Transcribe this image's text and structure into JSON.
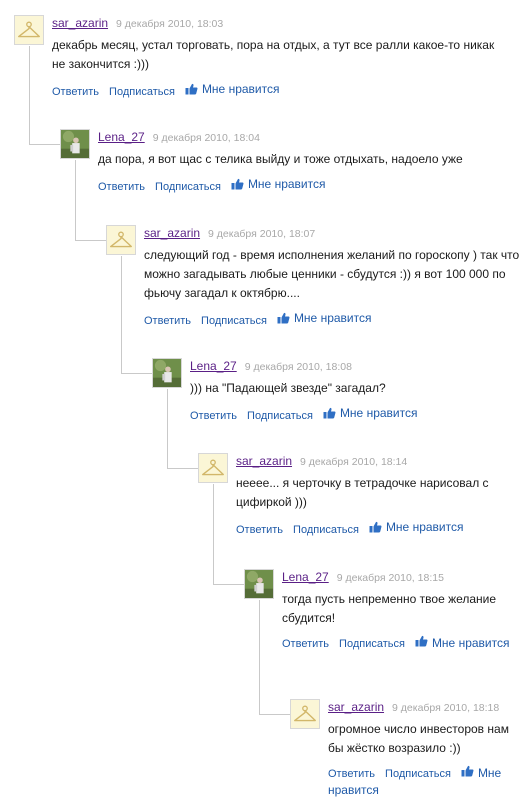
{
  "actions": {
    "reply_label": "Ответить",
    "subscribe_label": "Подписаться",
    "like_label": "Мне нравится"
  },
  "comments": [
    {
      "author": "sar_azarin",
      "date": "9 декабря 2010, 18:03",
      "text": "декабрь месяц, устал торговать, пора на отдых, а тут все ралли какое-то никак не закончится :)))",
      "avatar": "hanger-avatar"
    },
    {
      "author": "Lena_27",
      "date": "9 декабря 2010, 18:04",
      "text": "да пора, я вот щас с телика выйду и тоже отдыхать, надоело уже",
      "avatar": "photo-avatar"
    },
    {
      "author": "sar_azarin",
      "date": "9 декабря 2010, 18:07",
      "text": "следующий год - время исполнения желаний по гороскопу ) так что можно загадывать любые ценники - сбудутся :)) я вот 100 000 по фьючу загадал к октябрю....",
      "avatar": "hanger-avatar"
    },
    {
      "author": "Lena_27",
      "date": "9 декабря 2010, 18:08",
      "text": "))) на \"Падающей звезде\" загадал?",
      "avatar": "photo-avatar"
    },
    {
      "author": "sar_azarin",
      "date": "9 декабря 2010, 18:14",
      "text": "нееее... я черточку в тетрадочке нарисовал с цифиркой )))",
      "avatar": "hanger-avatar"
    },
    {
      "author": "Lena_27",
      "date": "9 декабря 2010, 18:15",
      "text": "тогда пусть непременно твое желание сбудится!",
      "avatar": "photo-avatar"
    },
    {
      "author": "sar_azarin",
      "date": "9 декабря 2010, 18:18",
      "text": "огромное число инвесторов нам бы жёстко возразило :))",
      "avatar": "hanger-avatar"
    }
  ]
}
